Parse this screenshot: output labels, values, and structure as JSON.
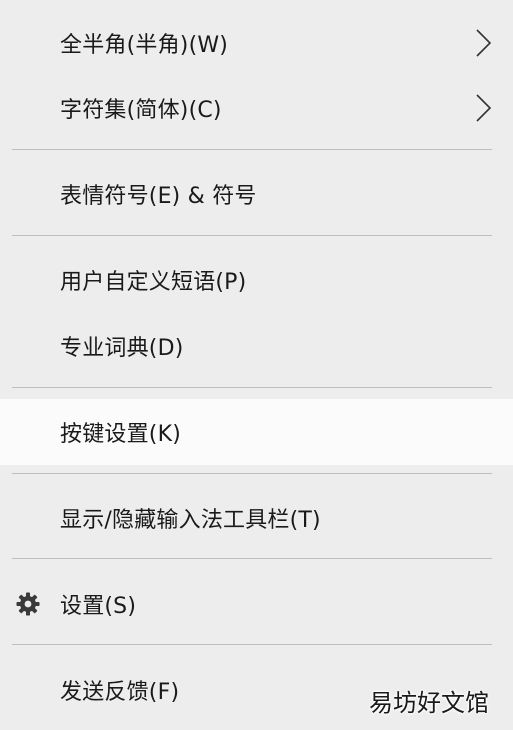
{
  "menu": {
    "items": [
      {
        "label": "全半角(半角)(W)"
      },
      {
        "label": "字符集(简体)(C)"
      },
      {
        "label": "表情符号(E) & 符号"
      },
      {
        "label": "用户自定义短语(P)"
      },
      {
        "label": "专业词典(D)"
      },
      {
        "label": "按键设置(K)"
      },
      {
        "label": "显示/隐藏输入法工具栏(T)"
      },
      {
        "label": "设置(S)"
      },
      {
        "label": "发送反馈(F)"
      }
    ]
  },
  "icons": {
    "submenu": "chevron-right-icon",
    "settings": "gear-icon"
  },
  "colors": {
    "background": "#ededed",
    "hover": "#fbfbfb",
    "separator": "#bdbdbd",
    "text": "#1a1a1a"
  },
  "watermark": {
    "text": "易坊好文馆"
  }
}
